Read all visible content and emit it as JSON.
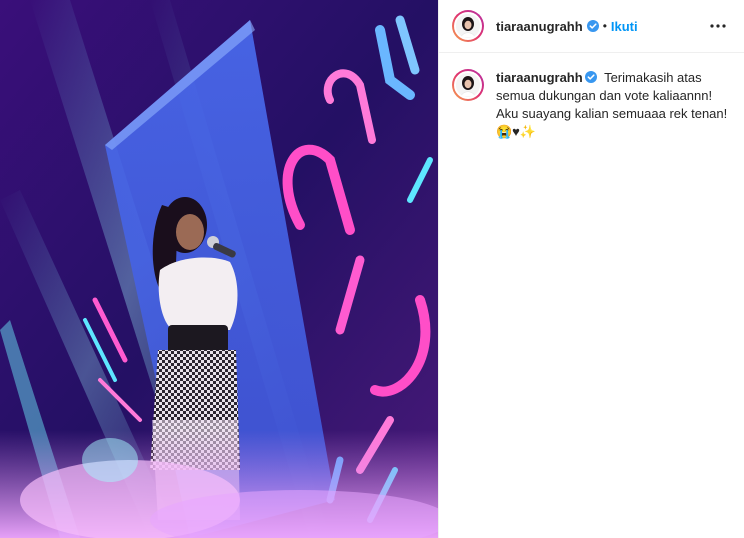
{
  "post": {
    "author": {
      "username": "tiaraanugrahh",
      "verified": true,
      "avatar_icon": "profile-photo"
    },
    "header": {
      "separator": "•",
      "follow_label": "Ikuti",
      "more_icon": "more-options-icon"
    },
    "caption": {
      "username": "tiaraanugrahh",
      "text": "Terimakasih atas semua dukungan dan vote kaliaannn! Aku suayang kalian semuaaa rek tenan!😭♥✨"
    },
    "colors": {
      "accent": "#0095f6",
      "verified": "#3897f0",
      "text": "#262626",
      "border": "#efefef"
    }
  }
}
